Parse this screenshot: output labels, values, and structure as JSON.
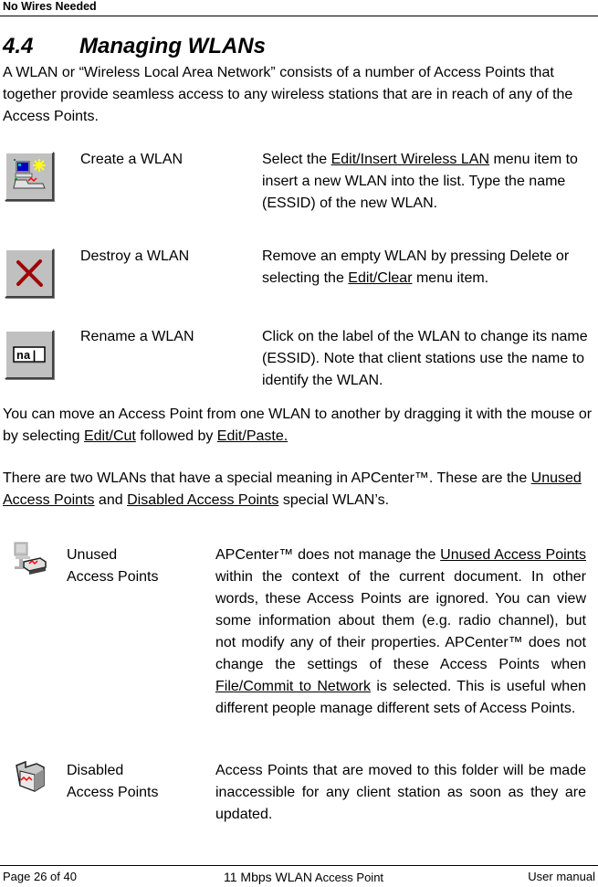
{
  "header": {
    "title": "No Wires Needed"
  },
  "section": {
    "number": "4.4",
    "title": "Managing WLANs"
  },
  "intro": "A WLAN or “Wireless Local Area Network” consists of a number of Access Points that together provide seamless access to any wireless stations that are in reach of any of the Access Points.",
  "actions": [
    {
      "icon": "create-wlan-icon",
      "label": "Create a WLAN",
      "desc_before": "Select the ",
      "desc_link": "Edit/Insert Wireless LAN",
      "desc_after": " menu item to insert a new WLAN into the list. Type the name (ESSID) of the new WLAN."
    },
    {
      "icon": "destroy-wlan-icon",
      "label": "Destroy a WLAN",
      "desc_before": "Remove an empty WLAN by pressing Delete or selecting the ",
      "desc_link": "Edit/Clear",
      "desc_after": " menu item."
    },
    {
      "icon": "rename-wlan-icon",
      "label": "Rename a WLAN",
      "desc": "Click on the label of the WLAN to change its name (ESSID). Note that client stations use the name to identify the WLAN."
    }
  ],
  "move_para": {
    "before": "You can move an Access Point from one WLAN to another by dragging it with the mouse or by selecting ",
    "link1": "Edit/Cut",
    "middle": " followed by ",
    "link2": "Edit/Paste."
  },
  "special_para": {
    "before": "There are two WLANs that have a special meaning in APCenter™. These are the ",
    "link1": "Unused Access Points",
    "middle": " and ",
    "link2": "Disabled Access Points",
    "after": " special WLAN’s."
  },
  "special": [
    {
      "icon": "unused-access-points-icon",
      "label_line1": "Unused",
      "label_line2": "Access Points",
      "desc_before": "APCenter™ does not manage the ",
      "desc_link1": "Unused Access Points",
      "desc_middle": " within the context of the current document. In other words, these Access Points are ignored. You can view some information about them (e.g. radio channel), but not modify any of their properties. APCenter™ does not change the settings of these Access Points when ",
      "desc_link2": "File/Commit to Network",
      "desc_after": " is selected. This is useful when different people manage different sets of Access Points."
    },
    {
      "icon": "disabled-access-points-icon",
      "label_line1": "Disabled",
      "label_line2": "Access Points",
      "desc": "Access Points that are moved to this folder will be made inaccessible for any client station as soon as they are updated."
    }
  ],
  "footer": {
    "page": "Page 26 of 40",
    "product_main": "11 Mbps WLAN",
    "product_small": " Access Point",
    "doc": "User manual"
  }
}
